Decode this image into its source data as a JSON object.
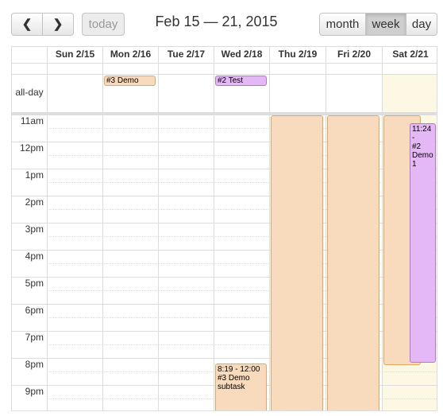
{
  "toolbar": {
    "prev_icon": "chevron-left-icon",
    "next_icon": "chevron-right-icon",
    "prev_glyph": "❮",
    "next_glyph": "❯",
    "today_label": "today",
    "title": "Feb 15 — 21, 2015",
    "views": {
      "month": "month",
      "week": "week",
      "day": "day"
    },
    "active_view": "week"
  },
  "calendar": {
    "days": [
      "Sun 2/15",
      "Mon 2/16",
      "Tue 2/17",
      "Wed 2/18",
      "Thu 2/19",
      "Fri 2/20",
      "Sat 2/21"
    ],
    "allday_label": "all-day",
    "hours": [
      "11am",
      "12pm",
      "1pm",
      "2pm",
      "3pm",
      "4pm",
      "5pm",
      "6pm",
      "7pm",
      "8pm",
      "9pm"
    ],
    "today_index": 6,
    "allday_events": [
      {
        "title": "#3 Demo",
        "day": "Mon 2/16"
      },
      {
        "title": "#2 Test",
        "day": "Wed 2/18"
      }
    ],
    "timed_events": [
      {
        "time": "8:19 - 12:00",
        "title": "#3 Demo subtask",
        "day": "Wed 2/18"
      },
      {
        "time": "",
        "title": "",
        "day": "Thu 2/19"
      },
      {
        "time": "",
        "title": "",
        "day": "Fri 2/20"
      },
      {
        "time": "",
        "title": "",
        "day": "Sat 2/21"
      },
      {
        "time": "11:24 -",
        "title": "#2 Demo 1",
        "day": "Sat 2/21"
      }
    ]
  },
  "colors": {
    "orange_event": "#f8dbbc",
    "orange_border": "#e8a460",
    "purple_event": "#e3b8f5",
    "purple_border": "#b476d0",
    "today_bg": "#fcf8e3",
    "grid_line": "#dddddd"
  }
}
